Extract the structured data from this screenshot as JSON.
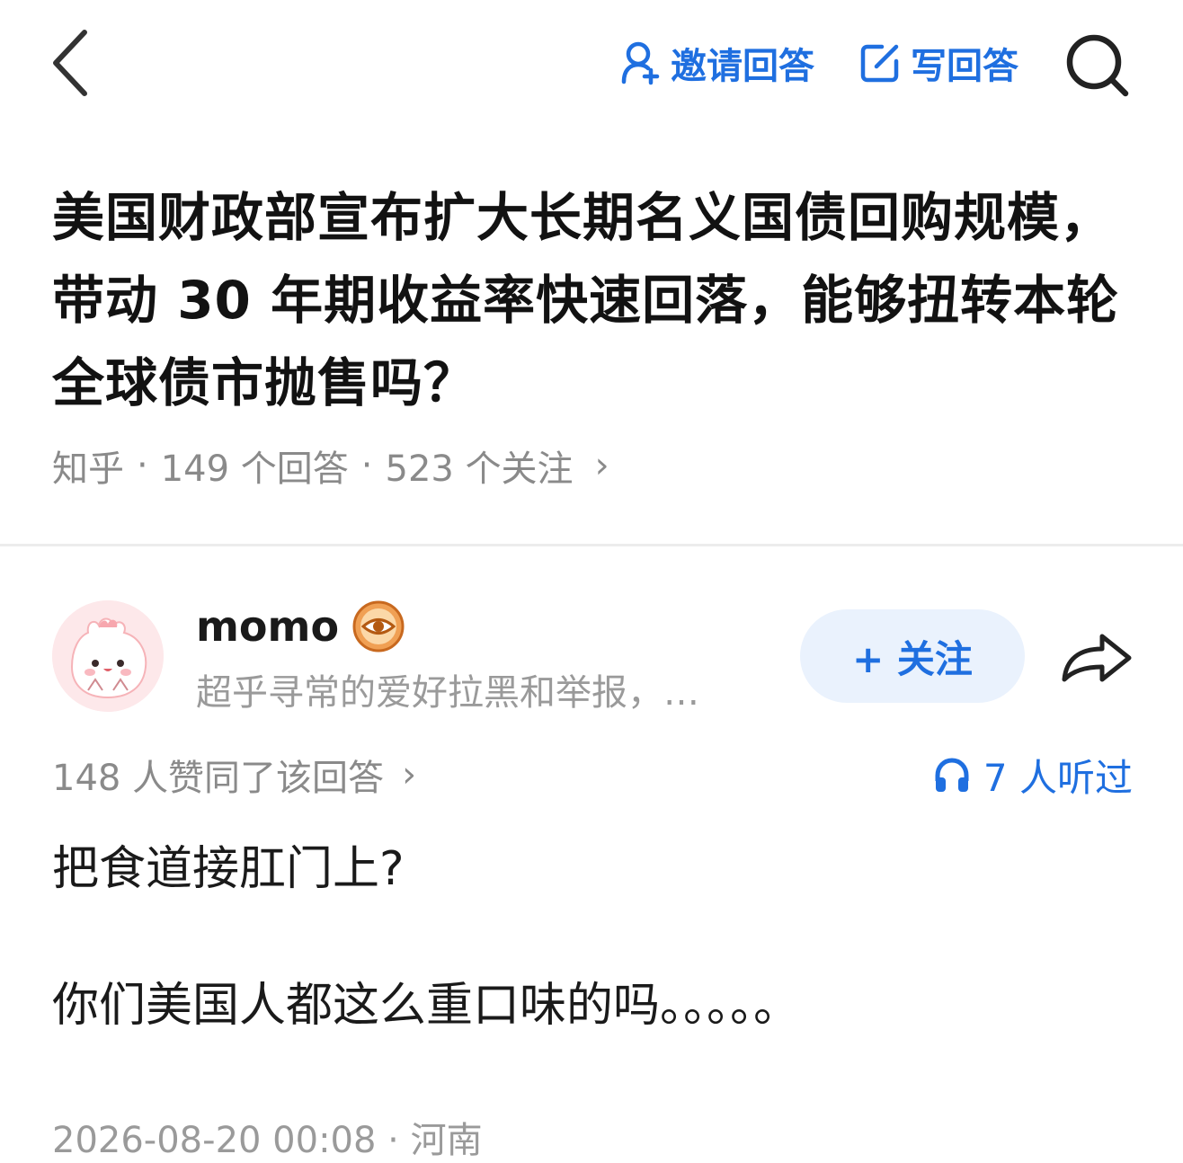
{
  "header": {
    "invite_label": "邀请回答",
    "write_label": "写回答",
    "accent_color": "#1f6fe0",
    "icons": [
      "back-chevron-icon",
      "invite-person-icon",
      "edit-icon",
      "search-icon"
    ]
  },
  "question": {
    "title": "美国财政部宣布扩大长期名义国债回购规模，带动 30 年期收益率快速回落，能够扭转本轮全球债市抛售吗？",
    "source": "知乎",
    "answers": "149 个回答",
    "followers": "523 个关注",
    "chevron": "›"
  },
  "answer": {
    "author": "momo",
    "bio": "超乎寻常的爱好拉黑和举报，…",
    "follow_label": "+ 关注",
    "votes": "148 人赞同了该回答",
    "listen": "7 人听过",
    "paragraphs": [
      "把食道接肛门上?",
      "你们美国人都这么重口味的吗。。。。。"
    ],
    "footer": "2026-08-20 00:08 · 河南",
    "icons": [
      "avatar",
      "eye-badge-icon",
      "share-icon",
      "headphones-icon"
    ]
  }
}
